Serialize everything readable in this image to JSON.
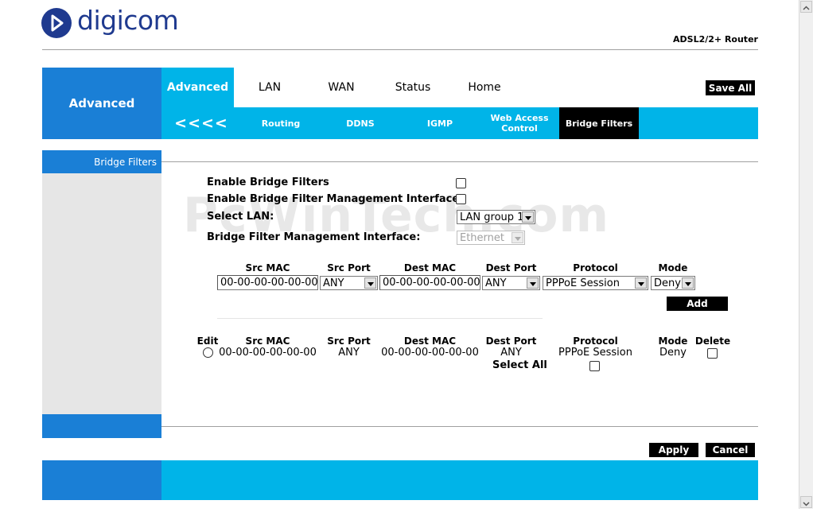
{
  "header": {
    "logo_text": "digicom",
    "product": "ADSL2/2+ Router"
  },
  "nav": {
    "section_title": "Advanced",
    "tabs": [
      "Advanced",
      "LAN",
      "WAN",
      "Status",
      "Home"
    ],
    "save_all": "Save All",
    "back_arrows": "<<<<",
    "subtabs": [
      "Routing",
      "DDNS",
      "IGMP",
      "Web Access Control",
      "Bridge Filters"
    ]
  },
  "sidebar": {
    "active_item": "Bridge Filters"
  },
  "watermark": "PcWinTech.com",
  "form": {
    "enable_bridge_filters": "Enable Bridge Filters",
    "enable_mgmt_interface": "Enable Bridge Filter Management Interface",
    "select_lan_label": "Select LAN:",
    "select_lan_value": "LAN group 1",
    "mgmt_interface_label": "Bridge Filter Management Interface:",
    "mgmt_interface_value": "Ethernet"
  },
  "entry": {
    "headers": [
      "Src MAC",
      "Src Port",
      "Dest MAC",
      "Dest Port",
      "Protocol",
      "Mode"
    ],
    "src_mac": "00-00-00-00-00-00",
    "src_port": "ANY",
    "dest_mac": "00-00-00-00-00-00",
    "dest_port": "ANY",
    "protocol": "PPPoE Session",
    "mode": "Deny",
    "add_label": "Add"
  },
  "table": {
    "headers": [
      "Edit",
      "Src MAC",
      "Src Port",
      "Dest MAC",
      "Dest Port",
      "Protocol",
      "Mode",
      "Delete"
    ],
    "rows": [
      {
        "src_mac": "00-00-00-00-00-00",
        "src_port": "ANY",
        "dest_mac": "00-00-00-00-00-00",
        "dest_port": "ANY",
        "protocol": "PPPoE Session",
        "mode": "Deny"
      }
    ],
    "select_all": "Select All"
  },
  "actions": {
    "apply": "Apply",
    "cancel": "Cancel"
  },
  "colors": {
    "primary_blue": "#1a7fd6",
    "cyan": "#00b4e8",
    "logo_blue": "#1f3a8f"
  }
}
